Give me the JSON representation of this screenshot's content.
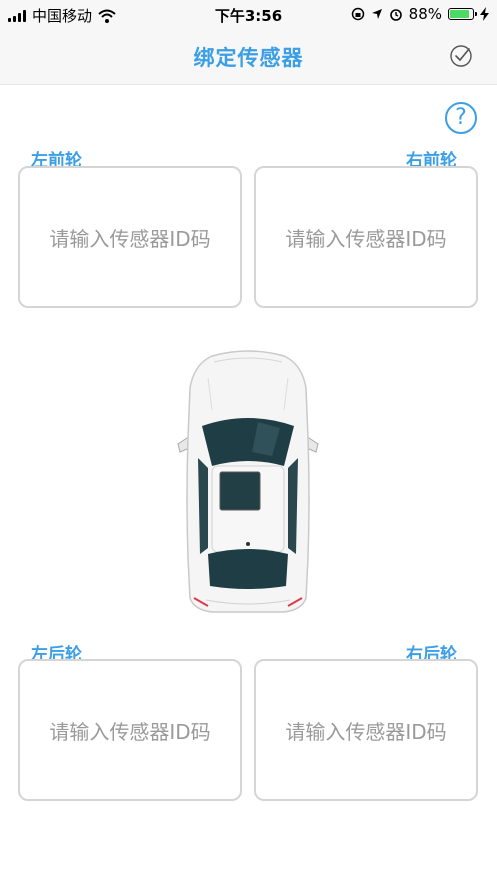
{
  "status_bar": {
    "carrier": "中国移动",
    "time": "下午3:56",
    "battery_text": "88%",
    "battery_level": 0.88,
    "battery_color": "#4cd964"
  },
  "header": {
    "title": "绑定传感器",
    "confirm_icon": "check-circle-icon"
  },
  "help_icon": "?",
  "wheels": {
    "front_left": {
      "label": "左前轮",
      "placeholder": "请输入传感器ID码"
    },
    "front_right": {
      "label": "右前轮",
      "placeholder": "请输入传感器ID码"
    },
    "rear_left": {
      "label": "左后轮",
      "placeholder": "请输入传感器ID码"
    },
    "rear_right": {
      "label": "右后轮",
      "placeholder": "请输入传感器ID码"
    }
  },
  "colors": {
    "accent": "#3c9fe6",
    "placeholder": "#9a9a9a",
    "border": "#d5d5d5"
  }
}
